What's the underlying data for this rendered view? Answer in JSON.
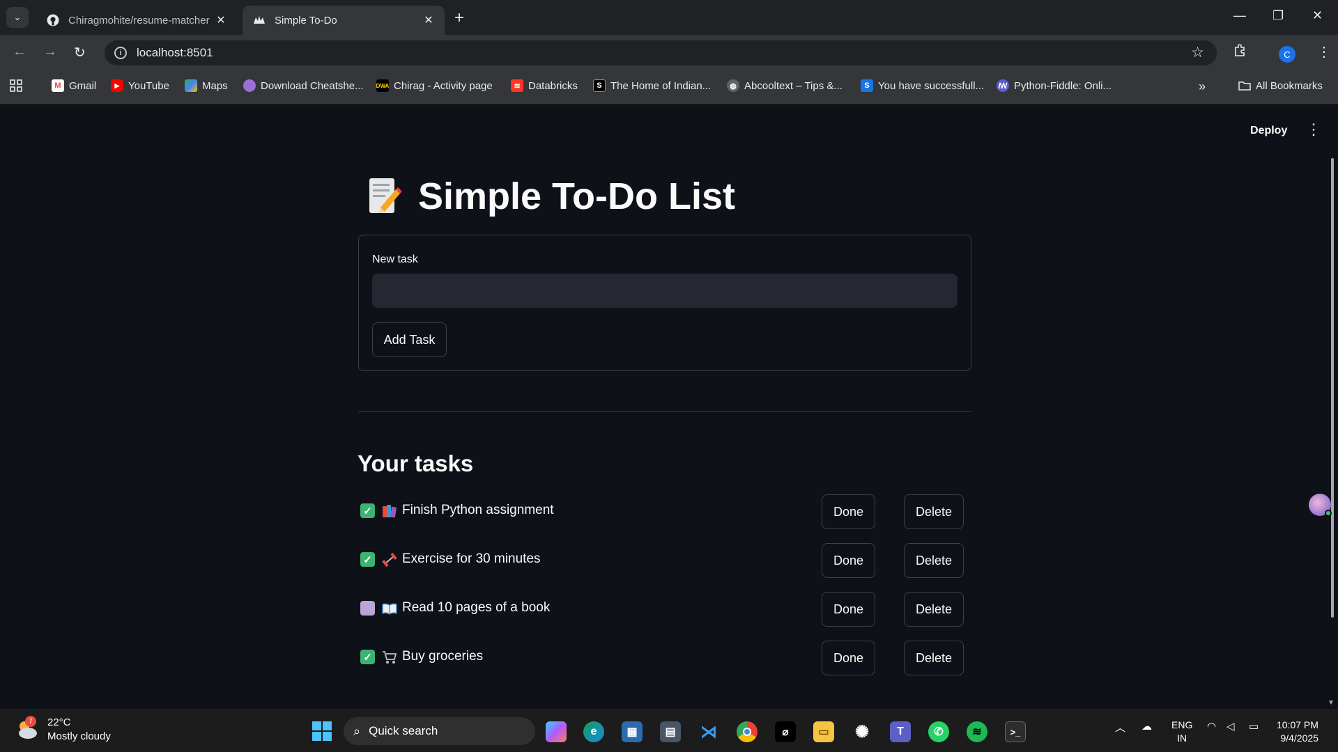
{
  "browser": {
    "tabs": [
      {
        "label": "Chiragmohite/resume-matcher",
        "icon": "github-icon",
        "active": false
      },
      {
        "label": "Simple To-Do",
        "icon": "streamlit-icon",
        "active": true
      }
    ],
    "url": "localhost:8501",
    "profile_initial": "C",
    "bookmarks": [
      {
        "label": "Gmail",
        "icon": "gmail-icon"
      },
      {
        "label": "YouTube",
        "icon": "youtube-icon"
      },
      {
        "label": "Maps",
        "icon": "maps-icon"
      },
      {
        "label": "Download Cheatshe...",
        "icon": "cheatsheet-icon"
      },
      {
        "label": "Chirag - Activity page",
        "icon": "dwa-icon"
      },
      {
        "label": "Databricks",
        "icon": "databricks-icon"
      },
      {
        "label": "The Home of Indian...",
        "icon": "s-icon"
      },
      {
        "label": "Abcooltext – Tips &...",
        "icon": "globe-icon"
      },
      {
        "label": "You have successfull...",
        "icon": "s-blue-icon"
      },
      {
        "label": "Python-Fiddle: Onli...",
        "icon": "python-fiddle-icon"
      }
    ],
    "all_bookmarks_label": "All Bookmarks"
  },
  "app": {
    "deploy_label": "Deploy",
    "title": "Simple To-Do List",
    "form": {
      "label": "New task",
      "input_value": "",
      "button_label": "Add Task"
    },
    "tasks_heading": "Your tasks",
    "tasks": [
      {
        "text": "Finish Python assignment",
        "checked": true,
        "emoji": "books",
        "done_label": "Done",
        "delete_label": "Delete"
      },
      {
        "text": "Exercise for 30 minutes",
        "checked": true,
        "emoji": "dumbbell",
        "done_label": "Done",
        "delete_label": "Delete"
      },
      {
        "text": "Read 10 pages of a book",
        "checked": false,
        "emoji": "open-book",
        "done_label": "Done",
        "delete_label": "Delete"
      },
      {
        "text": "Buy groceries",
        "checked": true,
        "emoji": "shopping-cart",
        "done_label": "Done",
        "delete_label": "Delete"
      }
    ],
    "colors": {
      "background": "#0e1117",
      "checked": "#3cb371",
      "unchecked": "#b7a6d6",
      "border": "#3d4049"
    }
  },
  "taskbar": {
    "weather": {
      "temp": "22°C",
      "desc": "Mostly cloudy",
      "badge": "7"
    },
    "search_label": "Quick search",
    "lang": {
      "line1": "ENG",
      "line2": "IN"
    },
    "clock": {
      "time": "10:07 PM",
      "date": "9/4/2025"
    }
  }
}
